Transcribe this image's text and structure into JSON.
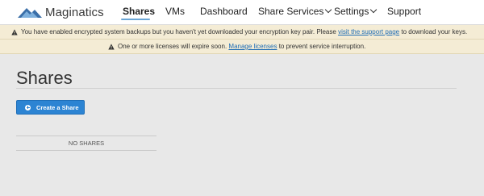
{
  "brand": {
    "name": "Maginatics",
    "logo_color": "#3b6fa8"
  },
  "nav": {
    "items": [
      {
        "label": "Shares",
        "active": true,
        "dropdown": false
      },
      {
        "label": "VMs",
        "active": false,
        "dropdown": false
      },
      {
        "label": "Dashboard",
        "active": false,
        "dropdown": false
      },
      {
        "label": "Share Services",
        "active": false,
        "dropdown": true
      },
      {
        "label": "Settings",
        "active": false,
        "dropdown": true
      },
      {
        "label": "Support",
        "active": false,
        "dropdown": false
      }
    ],
    "active_underline_color": "#6aa6d6"
  },
  "alerts": [
    {
      "icon": "warning-icon",
      "text_before": "You have enabled encrypted system backups but you haven't yet downloaded your encryption key pair. Please",
      "link_text": "visit the support page",
      "text_after": "to download your keys."
    },
    {
      "icon": "warning-icon",
      "text_before": "One or more licenses will expire soon.",
      "link_text": "Manage licenses",
      "text_after": "to prevent service interruption."
    }
  ],
  "page": {
    "title": "Shares",
    "create_button_label": "Create a Share",
    "empty_message": "NO SHARES"
  },
  "colors": {
    "primary_button": "#2c84d3",
    "alert_background": "#f4ecd5",
    "link": "#1f6db5",
    "page_background": "#e8e8e8"
  }
}
